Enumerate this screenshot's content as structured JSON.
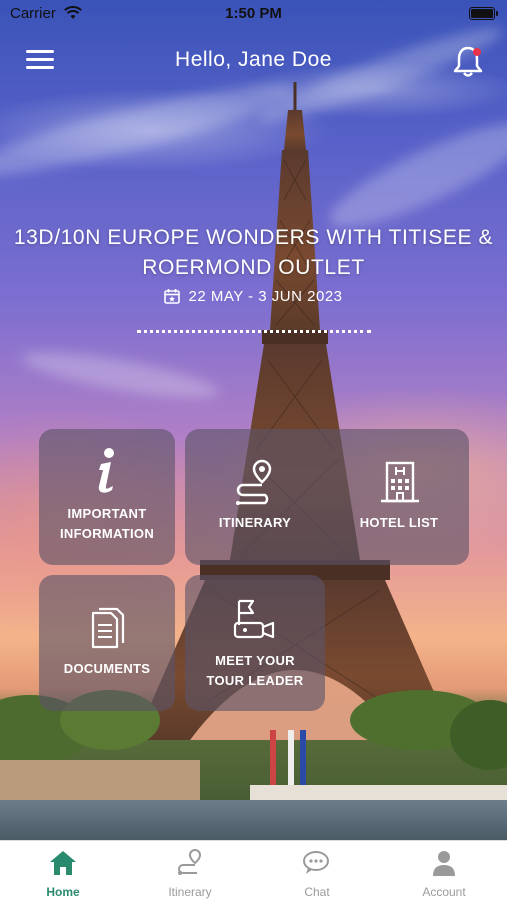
{
  "status_bar": {
    "carrier": "Carrier",
    "time": "1:50 PM"
  },
  "header": {
    "greeting": "Hello, Jane Doe",
    "menu_icon": "hamburger-menu-icon",
    "notification_icon": "bell-icon",
    "notification_dot_color": "#e8334a"
  },
  "trip": {
    "title": "13D/10N EUROPE WONDERS WITH TITISEE & ROERMOND OUTLET",
    "dates": "22 MAY - 3 JUN 2023",
    "date_icon": "calendar-icon"
  },
  "tiles": {
    "important_information": {
      "label_line1": "IMPORTANT",
      "label_line2": "INFORMATION",
      "icon": "info-icon"
    },
    "itinerary": {
      "label": "ITINERARY",
      "icon": "route-pin-icon"
    },
    "hotel_list": {
      "label": "HOTEL LIST",
      "icon": "hotel-building-icon"
    },
    "documents": {
      "label": "DOCUMENTS",
      "icon": "documents-icon"
    },
    "meet_tour_leader": {
      "label_line1": "MEET YOUR",
      "label_line2": "TOUR LEADER",
      "icon": "tour-leader-flag-icon"
    }
  },
  "bottom_nav": {
    "active_color": "#2a8a6e",
    "items": [
      {
        "label": "Home",
        "icon": "home-icon",
        "active": true
      },
      {
        "label": "Itinerary",
        "icon": "route-icon",
        "active": false
      },
      {
        "label": "Chat",
        "icon": "chat-bubbles-icon",
        "active": false
      },
      {
        "label": "Account",
        "icon": "person-icon",
        "active": false
      }
    ]
  }
}
